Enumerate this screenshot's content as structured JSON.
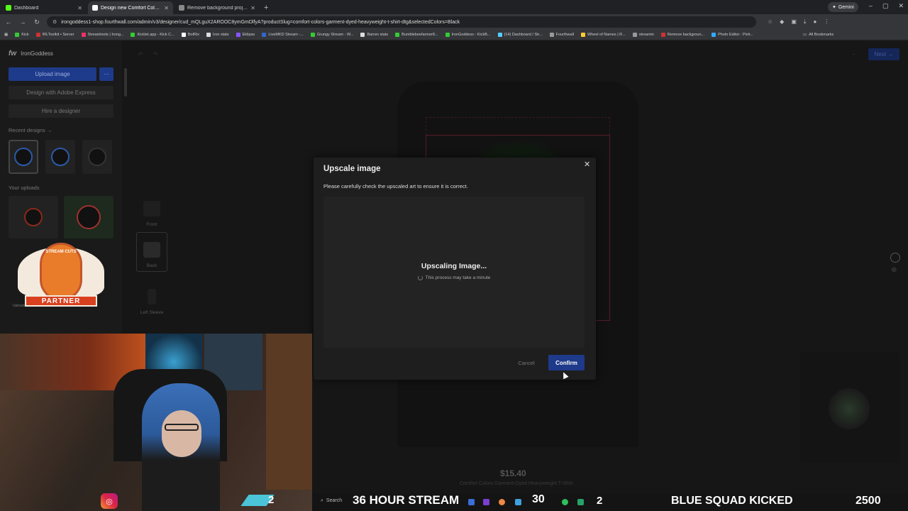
{
  "browser": {
    "tabs": [
      {
        "label": "Dashboard"
      },
      {
        "label": "Design new Comfort Colors Ga"
      },
      {
        "label": "Remove background project - I"
      }
    ],
    "gemini_label": "Gemini",
    "url": "irongoddess1-shop.fourthwall.com/admin/v3/designer/cud_mQLguX2AROOC8ymGmDlfyA?productSlug=comfort-colors-garment-dyed-heavyweight-t-shirt-dtg&selectedColors=Black",
    "bookmarks": [
      "Kick",
      "IRLToolkit • Server",
      "Streamloots | Irong...",
      "Kicklet.app - Kick C...",
      "BotRix",
      "Iron stats",
      "Eklipse",
      "LiveMKD Stream -...",
      "Grungy Stream - W...",
      "Barren stats",
      "Bumblebeefarmer8...",
      "IronGoddess - KickB...",
      "(14) Dashboard / Str...",
      "Fourthwall",
      "Wheel of Names | R...",
      "streamin",
      "Remove backgroun...",
      "Photo Editor : Pixlr..."
    ],
    "all_bookmarks": "All Bookmarks"
  },
  "app": {
    "brand_logo": "fw",
    "brand_name": "IronGoddess",
    "upload_label": "Upload image",
    "more_label": "···",
    "adobe_label": "Design with Adobe Express",
    "hire_label": "Hire a designer",
    "recent_label": "Recent designs →",
    "uploads_label": "Your uploads",
    "views": [
      "Front",
      "Back",
      "Left Sleeve"
    ],
    "next_label": "Next →",
    "price": "$15.40",
    "product_name": "Comfort Colors Garment-Dyed Heavyweight T-Shirt",
    "uploads_caption": "Uploads"
  },
  "modal": {
    "title": "Upscale image",
    "close": "✕",
    "description": "Please carefully check the upscaled art to ensure it is correct.",
    "status": "Upscaling Image...",
    "substatus": "This process may take a minute",
    "cancel": "Cancel",
    "confirm": "Confirm"
  },
  "overlay": {
    "badge_top": "STREAM CUTS",
    "badge_ribbon": "PARTNER",
    "search": "Search",
    "hour_stream": "36 HOUR STREAM",
    "n30": "30",
    "n2a": "2",
    "n2b": "2",
    "blue_squad": "BLUE SQUAD KICKED",
    "n2500": "2500"
  },
  "colors": {
    "accent": "#1e3a8a",
    "modal_bg": "#1e1e1e"
  }
}
